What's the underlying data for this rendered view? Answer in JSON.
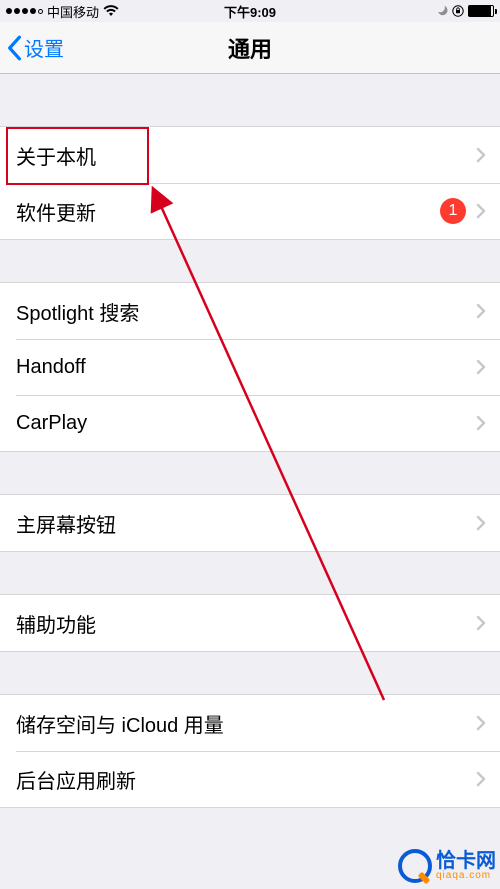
{
  "status": {
    "carrier": "中国移动",
    "time": "下午9:09"
  },
  "nav": {
    "back_label": "设置",
    "title": "通用"
  },
  "groups": [
    {
      "rows": [
        {
          "label": "关于本机",
          "badge": null
        },
        {
          "label": "软件更新",
          "badge": "1"
        }
      ]
    },
    {
      "rows": [
        {
          "label": "Spotlight 搜索",
          "badge": null
        },
        {
          "label": "Handoff",
          "badge": null
        },
        {
          "label": "CarPlay",
          "badge": null
        }
      ]
    },
    {
      "rows": [
        {
          "label": "主屏幕按钮",
          "badge": null
        }
      ]
    },
    {
      "rows": [
        {
          "label": "辅助功能",
          "badge": null
        }
      ]
    },
    {
      "rows": [
        {
          "label": "储存空间与 iCloud 用量",
          "badge": null
        },
        {
          "label": "后台应用刷新",
          "badge": null
        }
      ]
    }
  ],
  "annotation": {
    "highlight_row_index": 0
  },
  "watermark": {
    "cn": "恰卡网",
    "en": "qiaqa.com"
  }
}
